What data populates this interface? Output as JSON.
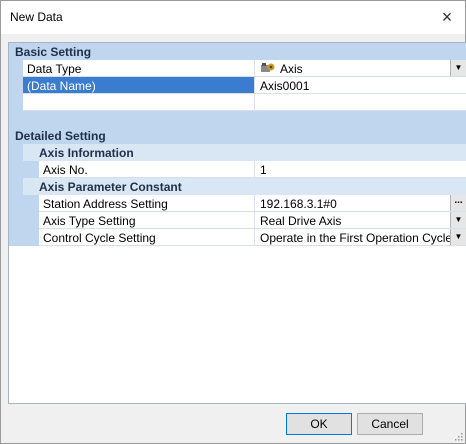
{
  "dialog": {
    "title": "New Data",
    "close_glyph": "×"
  },
  "sections": {
    "basic": {
      "label": "Basic Setting",
      "data_type": {
        "name": "Data Type",
        "value": "Axis",
        "icon": "axis-icon"
      },
      "data_name": {
        "name": "(Data Name)",
        "value": "Axis0001"
      }
    },
    "detailed": {
      "label": "Detailed Setting",
      "axis_info": {
        "label": "Axis Information",
        "axis_no": {
          "name": "Axis No.",
          "value": "1"
        }
      },
      "axis_param": {
        "label": "Axis Parameter Constant",
        "station": {
          "name": "Station Address Setting",
          "value": "192.168.3.1#0",
          "button": "..."
        },
        "axis_type": {
          "name": "Axis Type Setting",
          "value": "Real Drive Axis"
        },
        "control_cycle": {
          "name": "Control Cycle Setting",
          "value": "Operate in the First Operation Cycle"
        }
      }
    }
  },
  "buttons": {
    "ok": "OK",
    "cancel": "Cancel"
  },
  "colors": {
    "category_bg": "#bfd6ee",
    "selected_bg": "#3a7ccf"
  }
}
